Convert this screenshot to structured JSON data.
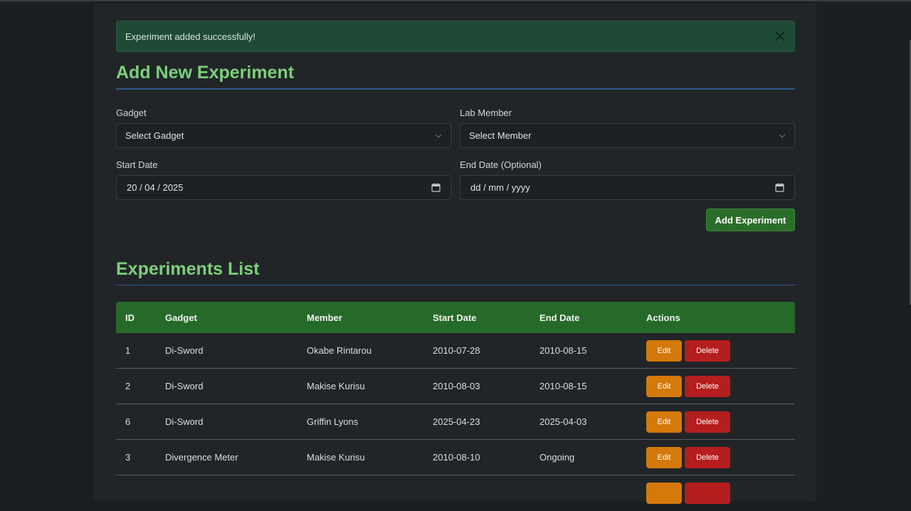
{
  "alert": {
    "message": "Experiment added successfully!"
  },
  "form": {
    "title": "Add New Experiment",
    "gadget_label": "Gadget",
    "gadget_value": "Select Gadget",
    "member_label": "Lab Member",
    "member_value": "Select Member",
    "start_label": "Start Date",
    "start_value": "20 / 04 / 2025",
    "end_label": "End Date (Optional)",
    "end_value": "dd / mm / yyyy",
    "submit_label": "Add Experiment"
  },
  "list": {
    "title": "Experiments List",
    "columns": [
      "ID",
      "Gadget",
      "Member",
      "Start Date",
      "End Date",
      "Actions"
    ],
    "edit_label": "Edit",
    "delete_label": "Delete",
    "rows": [
      {
        "id": "1",
        "gadget": "Di-Sword",
        "member": "Okabe Rintarou",
        "start": "2010-07-28",
        "end": "2010-08-15"
      },
      {
        "id": "2",
        "gadget": "Di-Sword",
        "member": "Makise Kurisu",
        "start": "2010-08-03",
        "end": "2010-08-15"
      },
      {
        "id": "6",
        "gadget": "Di-Sword",
        "member": "Griffin Lyons",
        "start": "2025-04-23",
        "end": "2025-04-03"
      },
      {
        "id": "3",
        "gadget": "Divergence Meter",
        "member": "Makise Kurisu",
        "start": "2010-08-10",
        "end": "Ongoing"
      }
    ]
  },
  "colors": {
    "accent_green": "#7ad07a",
    "header_green": "#266a2a",
    "edit_orange": "#d4790a",
    "delete_red": "#b51e1e",
    "rule_blue": "#2d5a8e"
  }
}
